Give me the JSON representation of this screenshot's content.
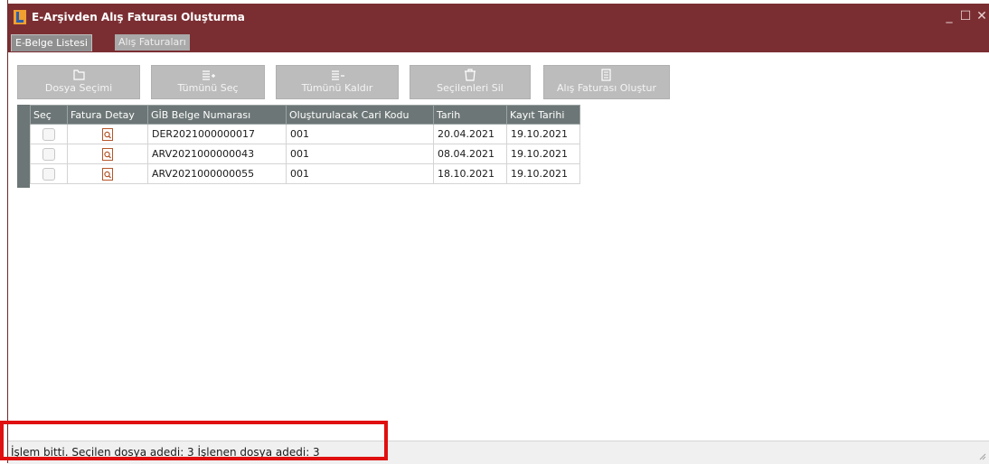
{
  "window": {
    "title": "E-Arşivden Alış Faturası Oluşturma",
    "minimize_glyph": "_",
    "maximize_glyph": "☐",
    "close_glyph": "✕",
    "app_icon": "logo-l-icon",
    "titlebar_color": "#7a2e32"
  },
  "tabs": [
    {
      "label": "E-Belge Listesi",
      "active": true
    },
    {
      "label": "Alış Faturaları",
      "active": false
    }
  ],
  "toolbar": {
    "buttons": [
      {
        "label": "Dosya Seçimi",
        "icon": "folder-icon",
        "enabled": false
      },
      {
        "label": "Tümünü Seç",
        "icon": "select-all-icon",
        "enabled": false
      },
      {
        "label": "Tümünü Kaldır",
        "icon": "deselect-all-icon",
        "enabled": false
      },
      {
        "label": "Seçilenleri Sil",
        "icon": "trash-icon",
        "enabled": false
      },
      {
        "label": "Alış Faturası Oluştur",
        "icon": "invoice-icon",
        "enabled": false
      }
    ]
  },
  "grid": {
    "columns": [
      "Seç",
      "Fatura Detay",
      "GİB Belge Numarası",
      "Oluşturulacak Cari Kodu",
      "Tarih",
      "Kayıt Tarihi"
    ],
    "rows": [
      {
        "selected": false,
        "gib_no": "DER2021000000017",
        "cari": "001",
        "tarih": "20.04.2021",
        "kayit": "19.10.2021"
      },
      {
        "selected": false,
        "gib_no": "ARV2021000000043",
        "cari": "001",
        "tarih": "08.04.2021",
        "kayit": "19.10.2021"
      },
      {
        "selected": false,
        "gib_no": "ARV2021000000055",
        "cari": "001",
        "tarih": "18.10.2021",
        "kayit": "19.10.2021"
      }
    ]
  },
  "status": {
    "text": "İşlem bitti. Seçilen dosya adedi: 3 İşlenen dosya adedi: 3"
  }
}
